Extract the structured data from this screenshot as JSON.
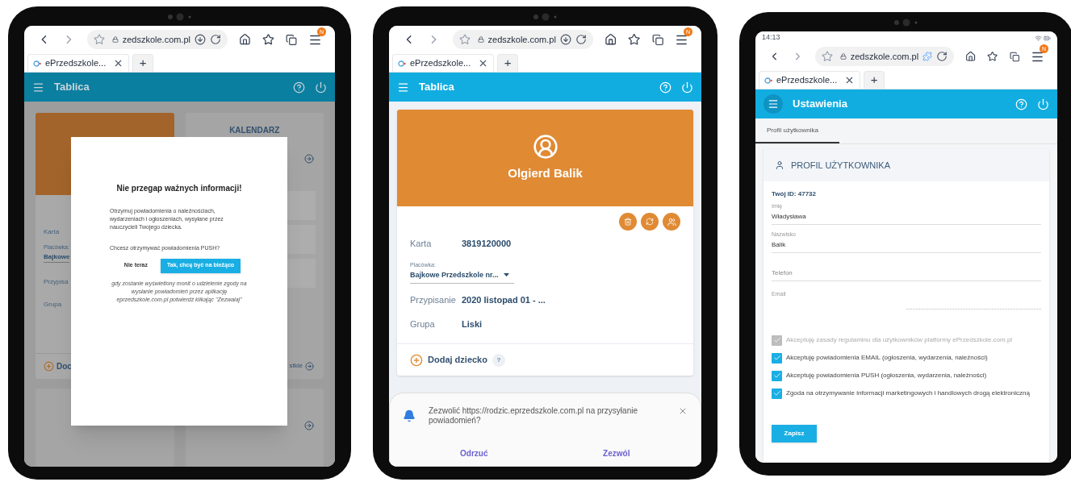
{
  "left_tablet": {
    "browser": {
      "url": "zedszkole.com.pl",
      "kind": "download",
      "tab_title": "ePrzedszkole...",
      "new_tab": "+",
      "badge": "N"
    },
    "dimmed": true,
    "app_bar": {
      "title": "Tablica"
    },
    "background": {
      "labels": [
        "Karta",
        "Placówka:",
        "Bajkowe",
        "Przypisa",
        "Grupa"
      ],
      "add_link": "Doc",
      "card_title": "KALENDARZ",
      "more_link": "stkie"
    },
    "modal": {
      "title": "Nie przegap ważnych informacji!",
      "body": "Otrzymuj powiadomienia o należnościach, wydarzeniach i ogłoszeniach, wysyłane przez nauczycieli Twojego dziecka.",
      "question": "Chcesz otrzymywać powiadomienia PUSH?",
      "buttons": [
        {
          "label": "Nie teraz",
          "primary": false
        },
        {
          "label": "Tak, chcę być na bieżąco",
          "primary": true
        }
      ],
      "note": "gdy zostanie wyświetlony monit o udzielenie zgody na wysłanie powiadomień przez aplikację eprzedszkole.com.pl potwierdź klikając \"Zezwalaj\""
    }
  },
  "middle_tablet": {
    "browser": {
      "url": "zedszkole.com.pl",
      "kind": "download",
      "tab_title": "ePrzedszkole...",
      "new_tab": "+",
      "badge": "N"
    },
    "app_bar": {
      "title": "Tablica"
    },
    "child": {
      "name": "Olgierd Balik",
      "card_label": "Karta",
      "card_value": "3819120000",
      "facility_label": "Placówka:",
      "facility_value": "Bajkowe Przedszkole nr...",
      "rows": [
        {
          "label": "Przypisanie",
          "value": "2020 listopad 01 - ..."
        },
        {
          "label": "Grupa",
          "value": "Liski"
        }
      ],
      "add_child": "Dodaj dziecko",
      "help": "?"
    },
    "permission": {
      "text": "Zezwolić https://rodzic.eprzedszkole.com.pl na przysyłanie powiadomień?",
      "deny": "Odrzuć",
      "allow": "Zezwól"
    }
  },
  "right_tablet": {
    "status_time": "14:13",
    "browser": {
      "url": "zedszkole.com.pl",
      "kind": "extension",
      "tab_title": "ePrzedszkole...",
      "new_tab": "+",
      "badge": "N"
    },
    "app_bar": {
      "title": "Ustawienia"
    },
    "tabs": [
      {
        "label": "Profil użytkownika",
        "selected": true
      }
    ],
    "profile": {
      "title": "PROFIL UŻYTKOWNIKA",
      "user_id": "Twój ID: 47732",
      "fields": [
        {
          "kind": "text",
          "label": "Imię",
          "value": "Władysława"
        },
        {
          "kind": "text",
          "label": "Nazwisko",
          "value": "Balik"
        },
        {
          "kind": "text",
          "placeholder": "Telefon"
        },
        {
          "kind": "readonly",
          "label": "Email"
        }
      ],
      "consents": [
        {
          "label": "Akceptuję zasady regulaminu dla użytkowników platformy ePrzedszkole.com.pl",
          "checked": true,
          "disabled": true
        },
        {
          "label": "Akceptuję powiadomienia EMAIL (ogłoszenia, wydarzenia, należności)",
          "checked": true,
          "disabled": false
        },
        {
          "label": "Akceptuję powiadomienia PUSH (ogłoszenia, wydarzenia, należności)",
          "checked": true,
          "disabled": false
        },
        {
          "label": "Zgoda na otrzymywanie informacji marketingowych i handlowych drogą elektroniczną",
          "checked": true,
          "disabled": false
        }
      ],
      "save": "Zapisz"
    }
  }
}
